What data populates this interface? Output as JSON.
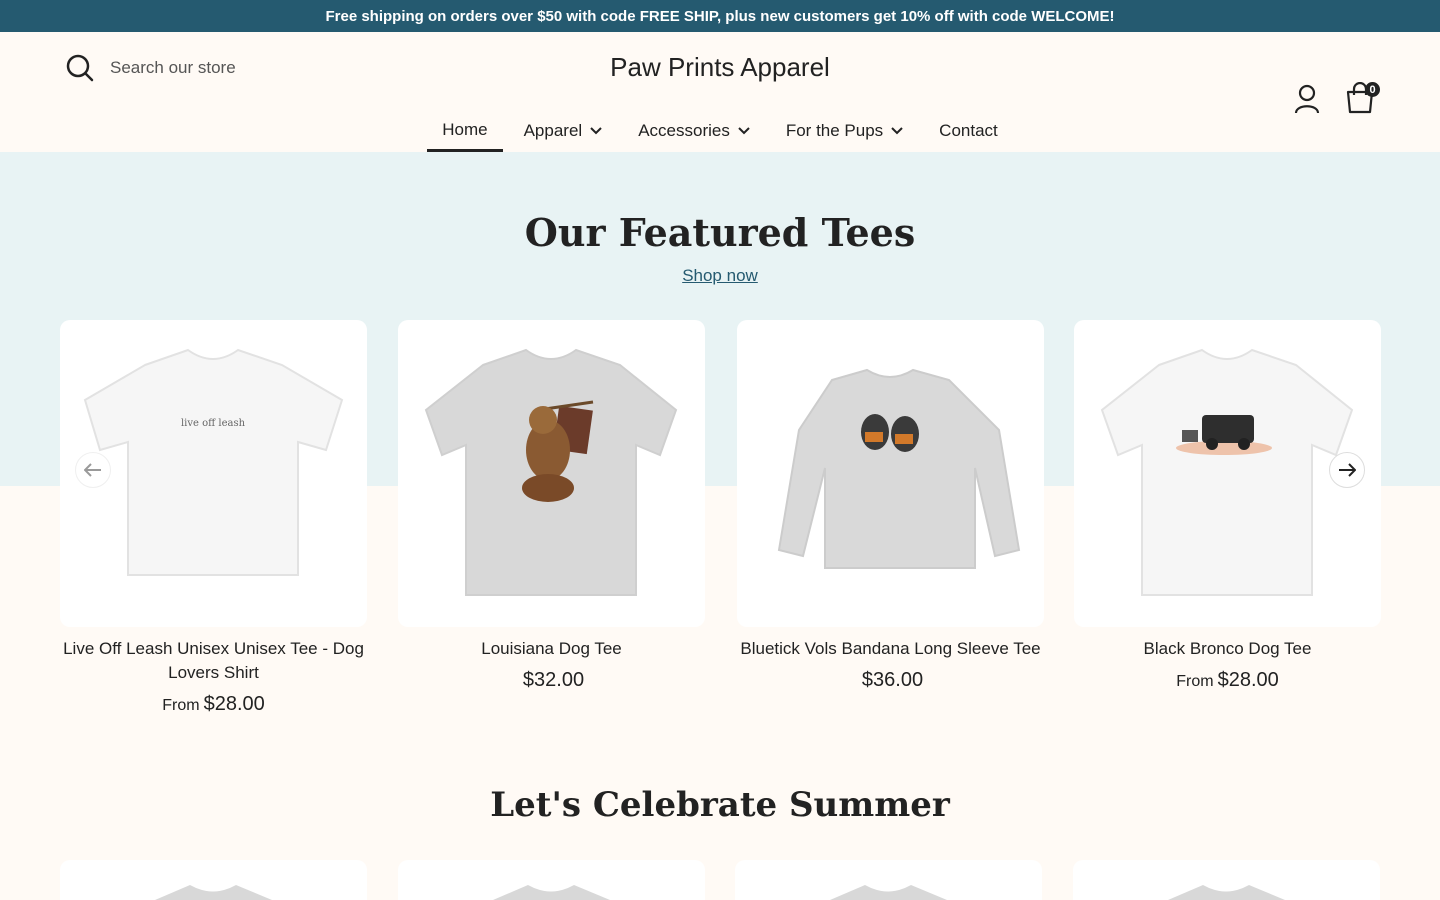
{
  "announcement": "Free shipping on orders over $50 with code FREE SHIP, plus new customers get 10% off with code WELCOME!",
  "header": {
    "search_placeholder": "Search our store",
    "logo": "Paw Prints Apparel",
    "cart_count": "0",
    "icons": [
      "search-icon",
      "account-icon",
      "cart-icon"
    ]
  },
  "nav": {
    "items": [
      {
        "label": "Home",
        "active": true,
        "dropdown": false
      },
      {
        "label": "Apparel",
        "active": false,
        "dropdown": true
      },
      {
        "label": "Accessories",
        "active": false,
        "dropdown": true
      },
      {
        "label": "For the Pups",
        "active": false,
        "dropdown": true
      },
      {
        "label": "Contact",
        "active": false,
        "dropdown": false
      }
    ]
  },
  "featured": {
    "title": "Our Featured Tees",
    "link": "Shop now",
    "products": [
      {
        "title": "Live Off Leash Unisex Unisex Tee - Dog Lovers Shirt",
        "from": "From",
        "price": "$28.00",
        "image_text": "live off leash"
      },
      {
        "title": "Louisiana Dog Tee",
        "from": "",
        "price": "$32.00"
      },
      {
        "title": "Bluetick Vols Bandana Long Sleeve Tee",
        "from": "",
        "price": "$36.00"
      },
      {
        "title": "Black Bronco Dog Tee",
        "from": "From",
        "price": "$28.00"
      }
    ]
  },
  "summer": {
    "title": "Let's Celebrate Summer"
  },
  "colors": {
    "announcement_bg": "#255a70",
    "band_bg": "#e8f3f4",
    "page_bg": "#fffaf5",
    "link": "#255a70"
  }
}
